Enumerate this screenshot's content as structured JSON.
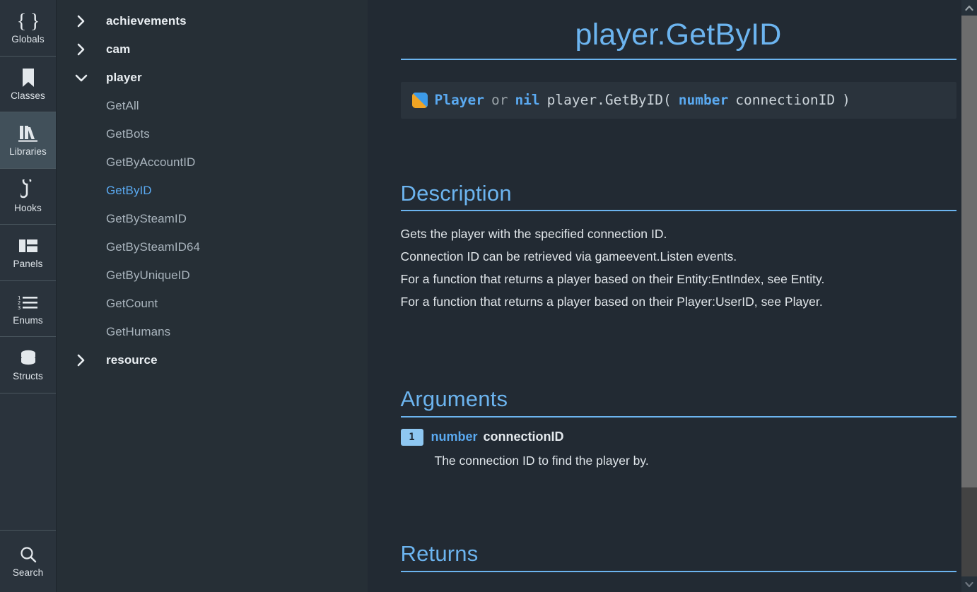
{
  "rail": {
    "items": [
      {
        "label": "Globals",
        "icon": "braces-icon",
        "active": false
      },
      {
        "label": "Classes",
        "icon": "book-icon",
        "active": false
      },
      {
        "label": "Libraries",
        "icon": "library-icon",
        "active": true
      },
      {
        "label": "Hooks",
        "icon": "hook-icon",
        "active": false
      },
      {
        "label": "Panels",
        "icon": "panels-icon",
        "active": false
      },
      {
        "label": "Enums",
        "icon": "list-icon",
        "active": false
      },
      {
        "label": "Structs",
        "icon": "database-icon",
        "active": false
      }
    ],
    "search": {
      "label": "Search",
      "icon": "search-icon"
    }
  },
  "tree": {
    "nodes": [
      {
        "label": "achievements",
        "type": "group",
        "expanded": false
      },
      {
        "label": "cam",
        "type": "group",
        "expanded": false
      },
      {
        "label": "player",
        "type": "group",
        "expanded": true
      },
      {
        "label": "GetAll",
        "type": "leaf",
        "selected": false
      },
      {
        "label": "GetBots",
        "type": "leaf",
        "selected": false
      },
      {
        "label": "GetByAccountID",
        "type": "leaf",
        "selected": false
      },
      {
        "label": "GetByID",
        "type": "leaf",
        "selected": true
      },
      {
        "label": "GetBySteamID",
        "type": "leaf",
        "selected": false
      },
      {
        "label": "GetBySteamID64",
        "type": "leaf",
        "selected": false
      },
      {
        "label": "GetByUniqueID",
        "type": "leaf",
        "selected": false
      },
      {
        "label": "GetCount",
        "type": "leaf",
        "selected": false
      },
      {
        "label": "GetHumans",
        "type": "leaf",
        "selected": false
      },
      {
        "label": "resource",
        "type": "group",
        "expanded": false
      }
    ]
  },
  "doc": {
    "title": "player.GetByID",
    "signature": {
      "realm_icon": "shared-realm-icon",
      "return_type": "Player",
      "or_keyword": "or",
      "nil_type": "nil",
      "call": "player.GetByID(",
      "arg_type": "number",
      "arg_name": " connectionID",
      "close_paren": ")"
    },
    "sections": {
      "description": {
        "heading": "Description",
        "lines": [
          "Gets the player with the specified connection ID.",
          "Connection ID can be retrieved via gameevent.Listen events.",
          "For a function that returns a player based on their Entity:EntIndex, see Entity.",
          "For a function that returns a player based on their Player:UserID, see Player."
        ]
      },
      "arguments": {
        "heading": "Arguments",
        "items": [
          {
            "number": "1",
            "type": "number",
            "name": " connectionID",
            "description": "The connection ID to find the player by."
          }
        ]
      },
      "returns": {
        "heading": "Returns"
      }
    }
  },
  "scrollbar": {
    "up_icon": "chevron-up-icon",
    "down_icon": "chevron-down-icon"
  },
  "colors": {
    "accent": "#6cb4ef",
    "type_blue": "#5aa9f0",
    "badge_blue": "#8ec7f2",
    "realm_orange": "#f0a424",
    "bg_main": "#222a33",
    "bg_tree": "#262f36",
    "bg_rail": "#2a333c"
  }
}
